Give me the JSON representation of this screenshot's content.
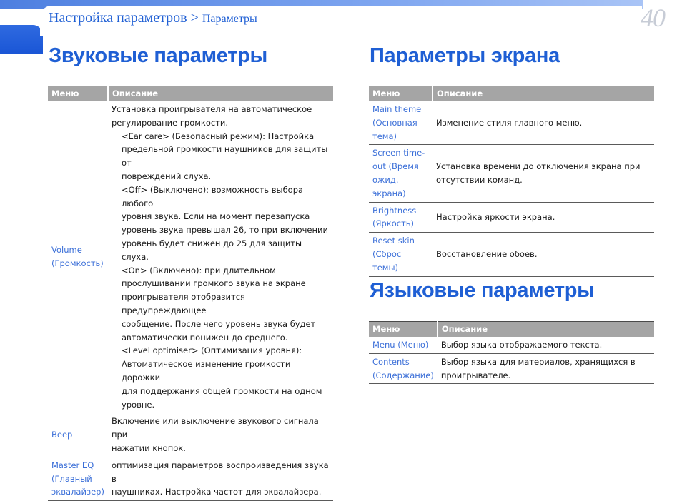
{
  "header": {
    "breadcrumb_main": "Настройка параметров >",
    "breadcrumb_sub": "Параметры",
    "page_number": "40"
  },
  "sound": {
    "title": "Звуковые параметры",
    "col_menu": "Меню",
    "col_desc": "Описание",
    "volume": {
      "menu": "Volume\n(Громкость)",
      "lines": [
        "Установка проигрывателя на автоматическое",
        "регулирование громкости.",
        "<Ear care> (Безопасный режим): Настройка",
        "предельной громкости наушников для защиты от",
        "повреждений слуха.",
        "<Off> (Выключено): возможность выбора любого",
        "уровня звука. Если на момент перезапуска",
        "уровень звука превышал 26, то при включении",
        "уровень будет снижен до 25 для защиты слуха.",
        "<On> (Включено): при длительном",
        "прослушивании громкого звука на экране",
        "проигрывателя отобразится предупреждающее",
        "сообщение. После чего уровень звука будет",
        "автоматически понижен до среднего.",
        "<Level optimiser> (Оптимизация уровня):",
        "Автоматическое изменение громкости дорожки",
        "для поддержания общей громкости на одном",
        "уровне."
      ]
    },
    "beep": {
      "menu": "Beep",
      "desc": "Включение или выключение звукового сигнала при\nнажатии кнопок."
    },
    "master_eq": {
      "menu": "Master EQ\n(Главный\nэквалайзер)",
      "desc": "оптимизация параметров воспроизведения звука в\nнаушниках. Настройка частот для эквалайзера."
    }
  },
  "screen": {
    "title": "Параметры экрана",
    "col_menu": "Меню",
    "col_desc": "Описание",
    "rows": [
      {
        "menu": "Main theme\n(Основная\nтема)",
        "desc": "Изменение стиля главного меню."
      },
      {
        "menu": "Screen time-\nout (Время\nожид. экрана)",
        "desc": "Установка времени до отключения экрана при\nотсутствии команд."
      },
      {
        "menu": "Brightness\n(Яркость)",
        "desc": "Настройка яркости экрана."
      },
      {
        "menu": "Reset skin\n(Сброс темы)",
        "desc": "Восстановление обоев."
      }
    ]
  },
  "language": {
    "title": "Языковые параметры",
    "col_menu": "Меню",
    "col_desc": "Описание",
    "rows": [
      {
        "menu": "Menu (Меню)",
        "desc": "Выбор языка отображаемого текста."
      },
      {
        "menu": "Contents\n(Содержание)",
        "desc": "Выбор языка для материалов, хранящихся в\nпроигрывателе."
      }
    ]
  },
  "colors": {
    "accent": "#1f5fd4",
    "menu_link": "#3b6fd8",
    "table_header": "#a5a5a5"
  }
}
